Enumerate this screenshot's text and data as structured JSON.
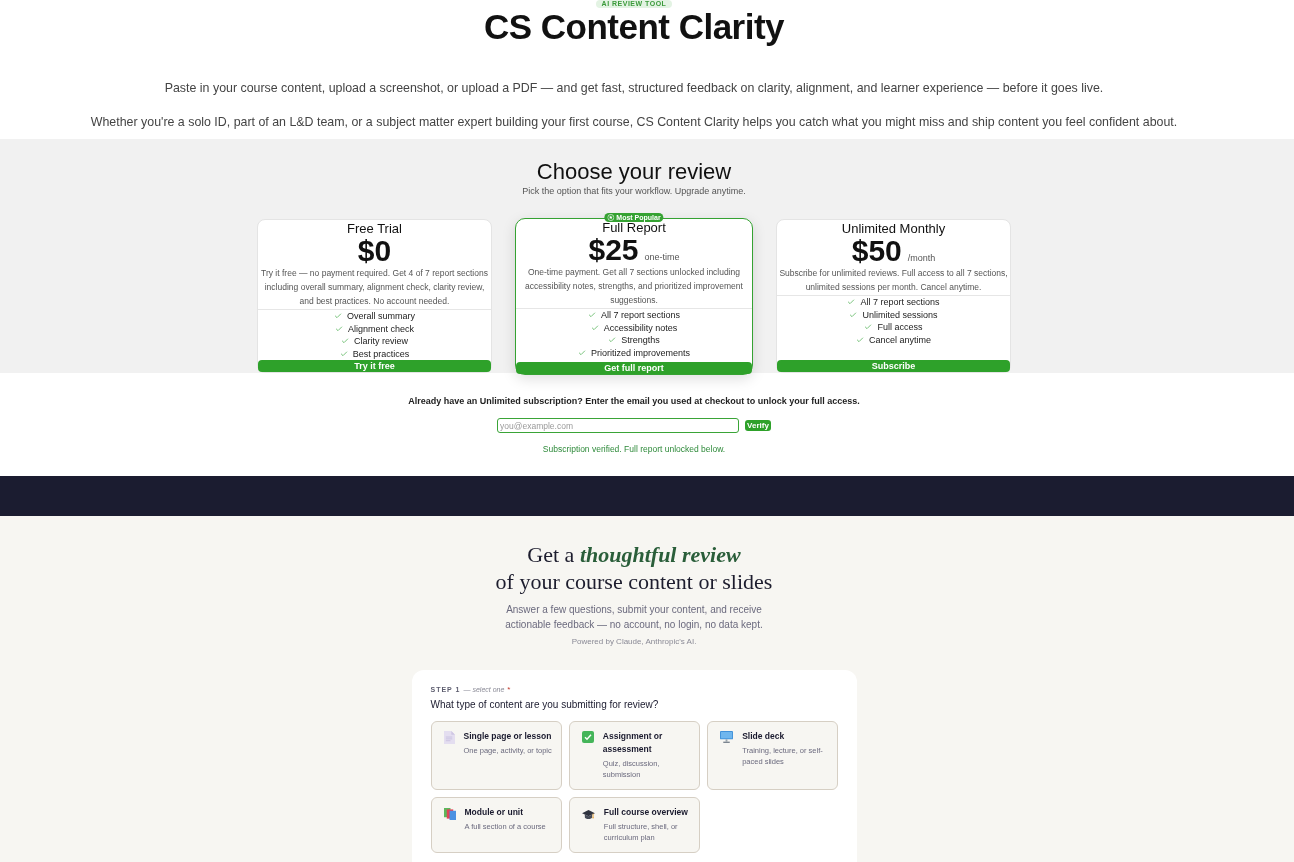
{
  "hero": {
    "eyebrow": "AI REVIEW TOOL",
    "title": "CS Content Clarity",
    "paragraphs": [
      "Paste in your course content, upload a screenshot, or upload a PDF — and get fast, structured feedback on clarity, alignment, and learner experience — before it goes live.",
      "Whether you're a solo ID, part of an L&D team, or a subject matter expert building your first course, CS Content Clarity helps you catch what you might miss and ship content you feel confident about."
    ]
  },
  "pricing": {
    "title": "Choose your review",
    "subtitle": "Pick the option that fits your workflow. Upgrade anytime.",
    "plans": [
      {
        "name": "Free Trial",
        "price": "$0",
        "description": "Try it free — no payment required. Get 4 of 7 report sections including overall summary, alignment check, clarity review, and best practices. No account needed.",
        "features": [
          "Overall summary",
          "Alignment check",
          "Clarity review",
          "Best practices"
        ],
        "button": "Try it free",
        "featured": false
      },
      {
        "name": "Full Report",
        "badge": "Most Popular",
        "price": "$25",
        "period": "one-time",
        "description": "One-time payment. Get all 7 sections unlocked including accessibility notes, strengths, and prioritized improvement suggestions.",
        "features": [
          "All 7 report sections",
          "Accessibility notes",
          "Strengths",
          "Prioritized improvements"
        ],
        "button": "Get full report",
        "featured": true
      },
      {
        "name": "Unlimited Monthly",
        "price": "$50",
        "period": "/month",
        "description": "Subscribe for unlimited reviews. Full access to all 7 sections, unlimited sessions per month. Cancel anytime.",
        "features": [
          "All 7 report sections",
          "Unlimited sessions",
          "Full access",
          "Cancel anytime"
        ],
        "button": "Subscribe",
        "featured": false
      }
    ]
  },
  "verify": {
    "prompt": "Already have an Unlimited subscription? Enter the email you used at checkout to unlock your full access.",
    "placeholder": "you@example.com",
    "button": "Verify",
    "status": "Subscription verified. Full report unlocked below."
  },
  "intro": {
    "heading": [
      "Get a *thoughtful review*",
      "of your course content or slides"
    ],
    "description": "Answer a few questions, submit your content, and receive actionable feedback — no account, no login, no data kept.",
    "note": "Powered by Claude, Anthropic's AI."
  },
  "step": {
    "label": "STEP 1",
    "hint": "— select one",
    "required_mark": "*",
    "question": "What type of content are you submitting for review?",
    "options": [
      {
        "kind": "page",
        "title": "Single page or lesson",
        "description": "One page, activity, or topic",
        "selected": false
      },
      {
        "kind": "assignment",
        "title": "Assignment or assessment",
        "description": "Quiz, discussion, submission",
        "selected": false
      },
      {
        "kind": "slides",
        "title": "Slide deck",
        "description": "Training, lecture, or self-paced slides",
        "selected": false
      },
      {
        "kind": "module",
        "title": "Module or unit",
        "description": "A full section of a course",
        "selected": false
      },
      {
        "kind": "course",
        "title": "Full course overview",
        "description": "Full structure, shell, or curriculum plan",
        "selected": false
      }
    ]
  }
}
